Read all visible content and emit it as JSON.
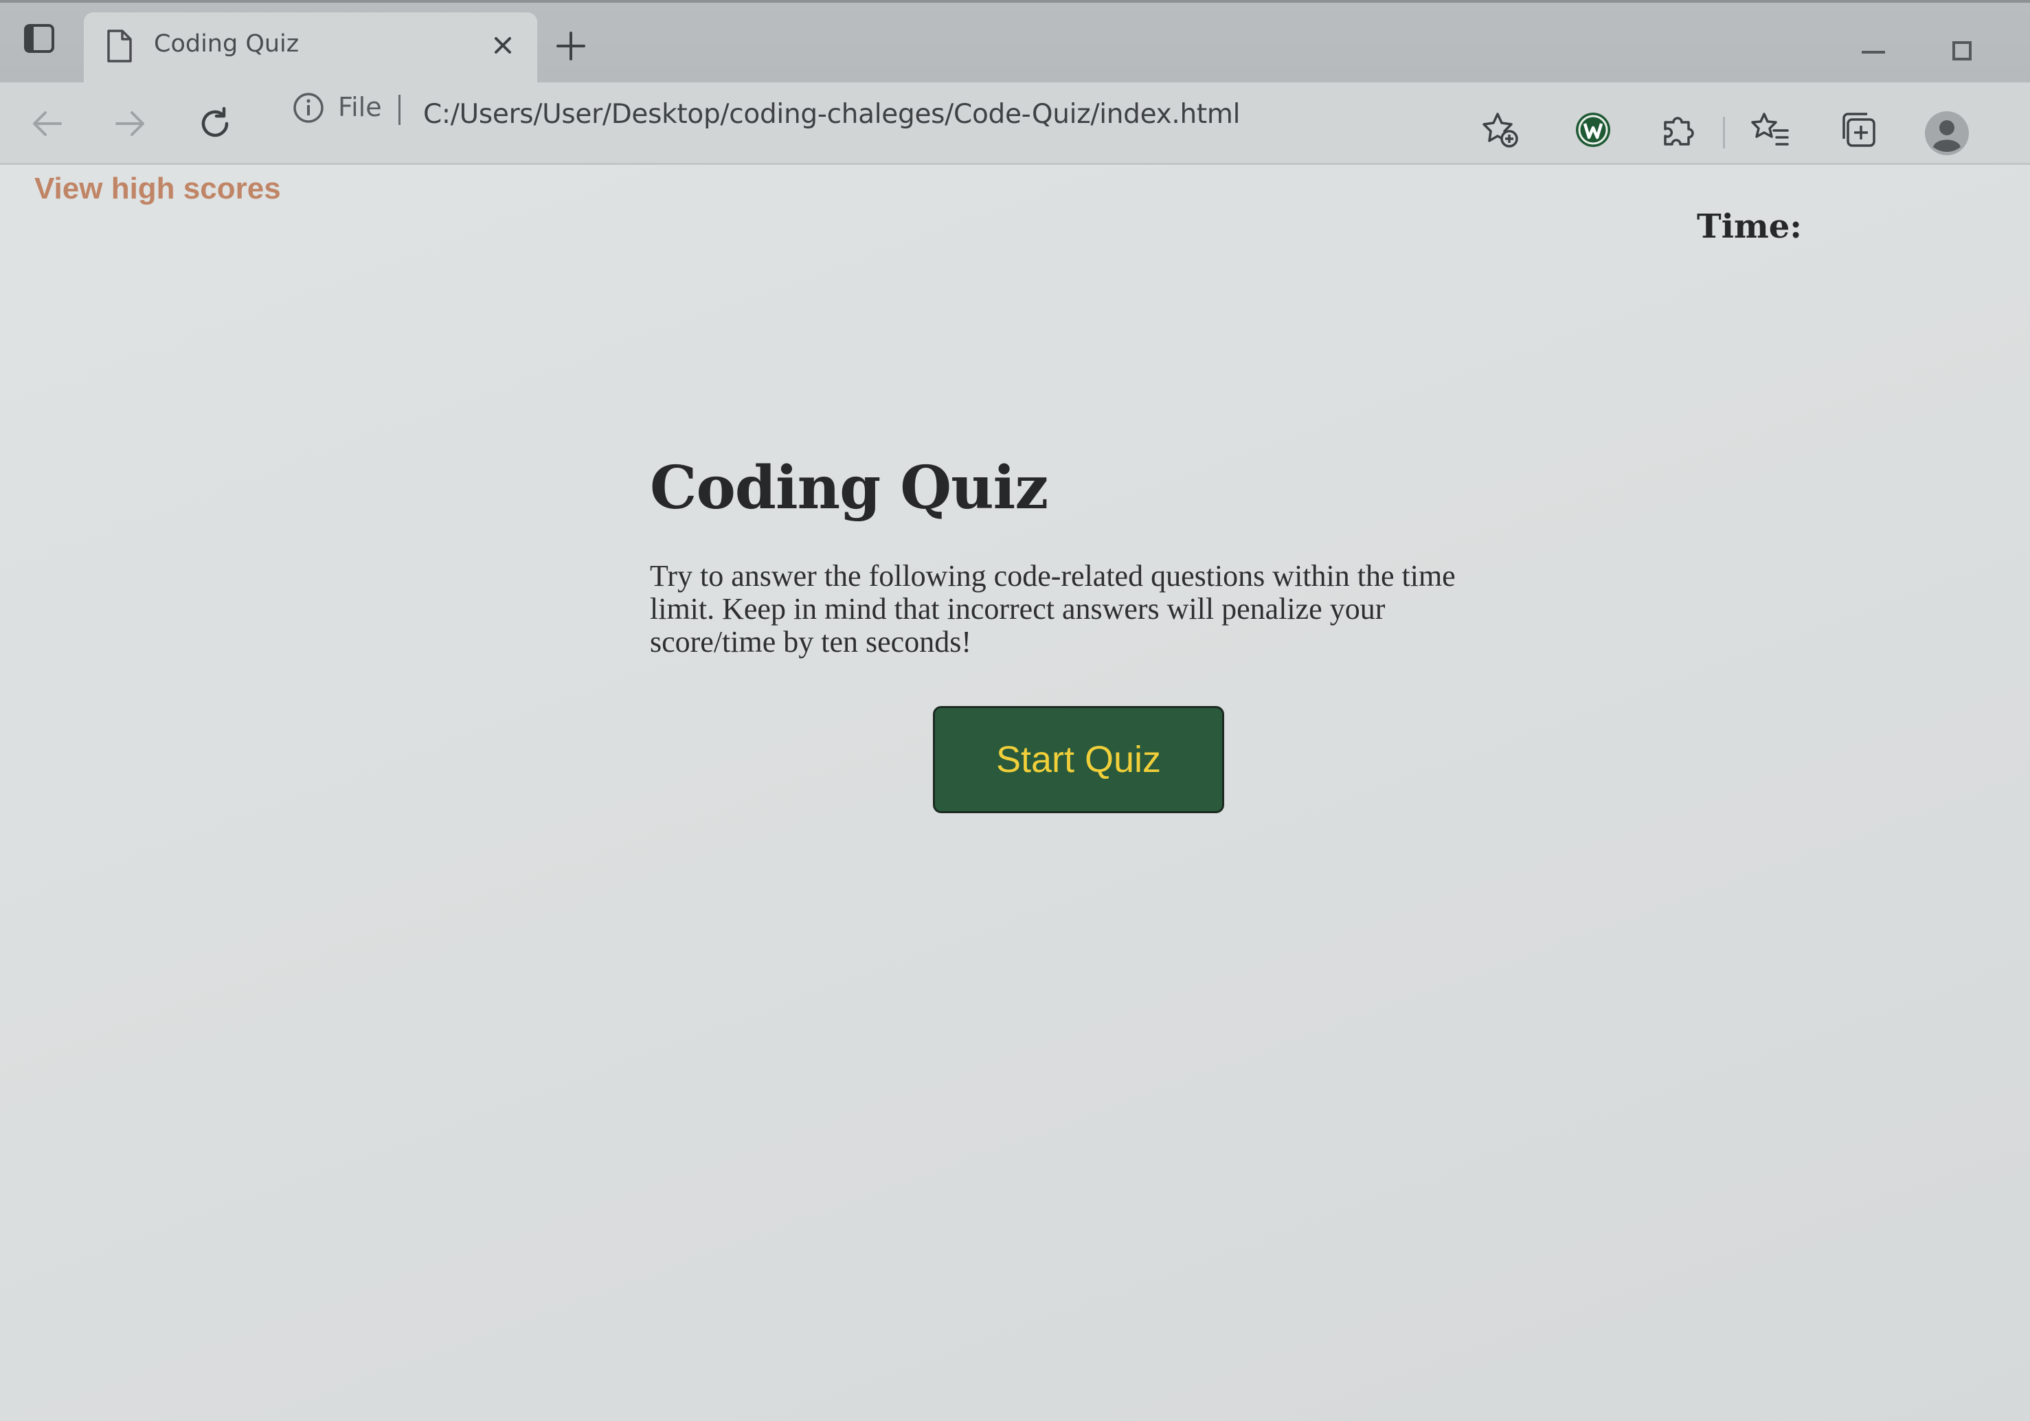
{
  "browser": {
    "tab": {
      "title": "Coding Quiz"
    },
    "address_bar": {
      "scheme_label": "File",
      "url": "C:/Users/User/Desktop/coding-chaleges/Code-Quiz/index.html"
    },
    "icons": {
      "tab_actions": "tab-actions-icon",
      "document": "document-icon",
      "close": "close-icon",
      "new_tab": "plus-icon",
      "back": "back-arrow-icon",
      "forward": "forward-arrow-icon",
      "reload": "reload-icon",
      "info": "info-icon",
      "add_favorite": "star-plus-icon",
      "extension": "w-extension-icon",
      "extensions": "puzzle-icon",
      "favorites": "favorites-icon",
      "collections": "collections-icon",
      "profile": "profile-icon"
    }
  },
  "page": {
    "high_scores_link": "View high scores",
    "timer_label": "Time:",
    "title": "Coding Quiz",
    "description": "Try to answer the following code-related questions within the time limit. Keep in mind that incorrect answers will penalize your score/time by ten seconds!",
    "start_button": "Start Quiz"
  },
  "colors": {
    "link": "#c08566",
    "button_bg": "#2a5a3b",
    "button_text": "#f1cf3a",
    "text": "#26282a"
  }
}
